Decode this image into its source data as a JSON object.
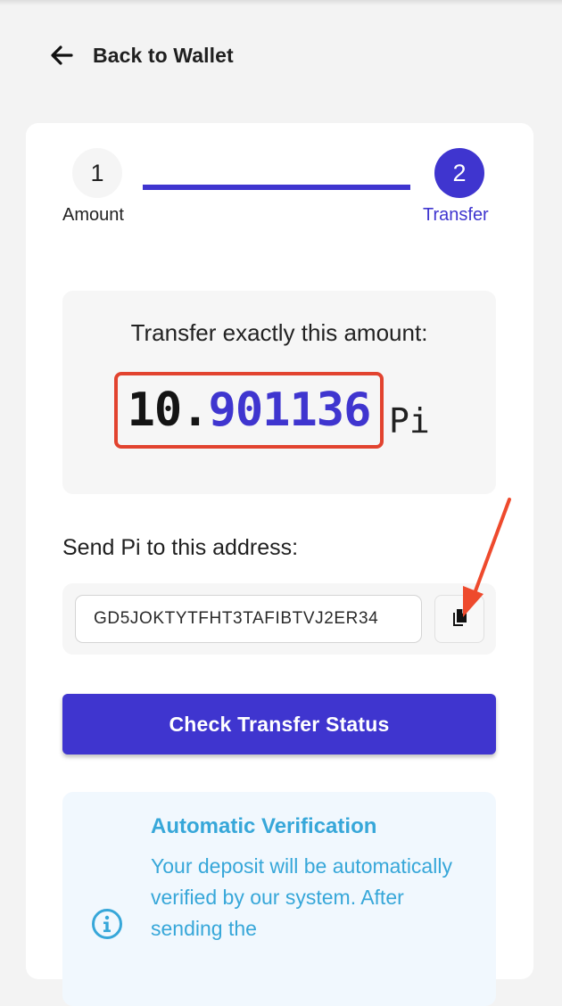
{
  "header": {
    "back_label": "Back to Wallet"
  },
  "stepper": {
    "steps": [
      {
        "number": "1",
        "label": "Amount"
      },
      {
        "number": "2",
        "label": "Transfer"
      }
    ],
    "active_step": 2
  },
  "amount": {
    "title": "Transfer exactly this amount:",
    "integer_part": "10.",
    "decimal_part": "901136",
    "unit": "Pi"
  },
  "address": {
    "title": "Send Pi to this address:",
    "value": "GD5JOKTYTFHT3TAFIBTVJ2ER34"
  },
  "actions": {
    "check_status_label": "Check Transfer Status"
  },
  "info": {
    "title": "Automatic Verification",
    "text": "Your deposit will be automatically verified by our system. After sending the"
  },
  "icons": {
    "back": "arrow-left-icon",
    "copy": "copy-icon",
    "info": "info-icon"
  },
  "colors": {
    "primary": "#3f35cf",
    "highlight_border": "#e2432f",
    "info_text": "#37a7d9",
    "info_background": "#f1f8fe"
  }
}
